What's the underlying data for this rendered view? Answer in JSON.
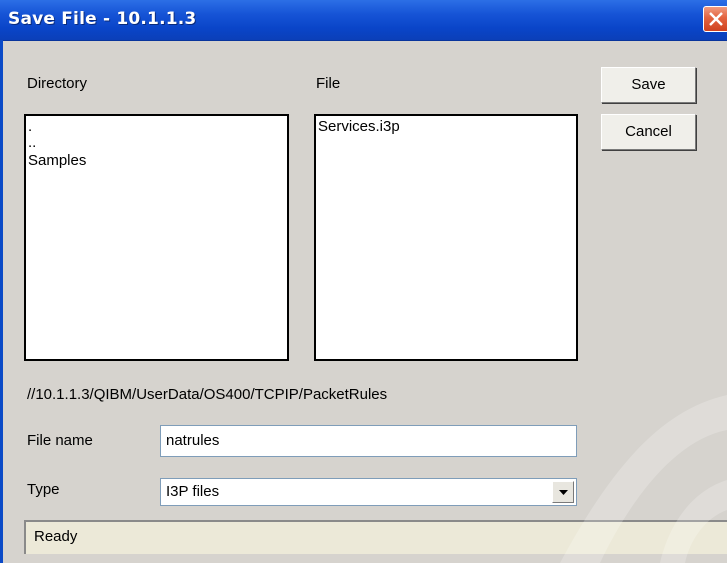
{
  "window": {
    "title": "Save File - 10.1.1.3"
  },
  "directory": {
    "label": "Directory",
    "items": [
      ".",
      "..",
      "Samples"
    ]
  },
  "file": {
    "label": "File",
    "items": [
      "Services.i3p"
    ]
  },
  "buttons": {
    "save": "Save",
    "cancel": "Cancel"
  },
  "path": "//10.1.1.3/QIBM/UserData/OS400/TCPIP/PacketRules",
  "filename": {
    "label": "File name",
    "value": "natrules"
  },
  "type": {
    "label": "Type",
    "value": "I3P files"
  },
  "status": "Ready"
}
